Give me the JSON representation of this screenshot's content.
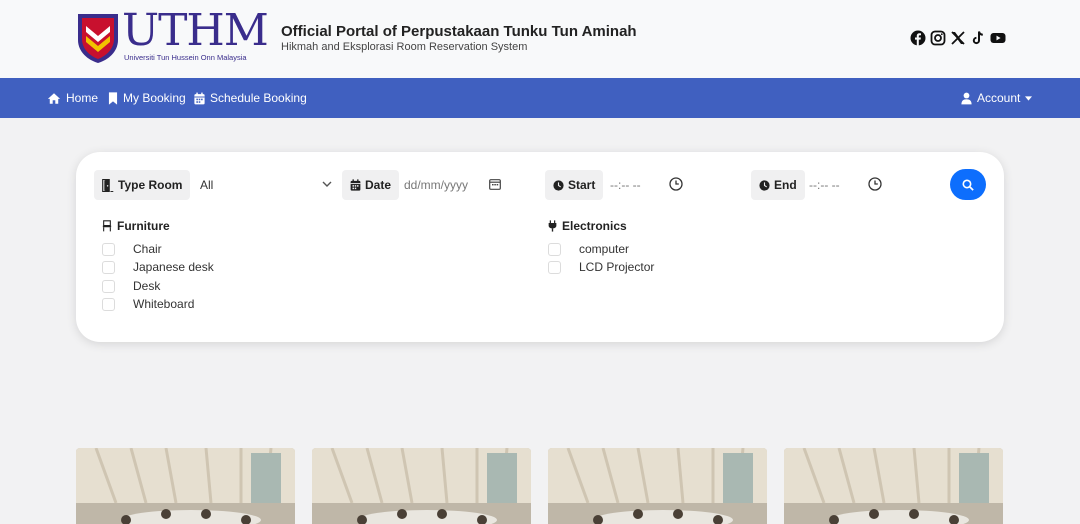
{
  "header": {
    "logo_text": "UTHM",
    "logo_subtitle": "Universiti Tun Hussein Onn Malaysia",
    "title": "Official Portal of Perpustakaan Tunku Tun Aminah",
    "subtitle": "Hikmah and Eksplorasi Room Reservation System",
    "socials": [
      "facebook-icon",
      "instagram-icon",
      "x-icon",
      "tiktok-icon",
      "youtube-icon"
    ]
  },
  "nav": {
    "home": "Home",
    "my_booking": "My Booking",
    "schedule_booking": "Schedule Booking",
    "account": "Account"
  },
  "search": {
    "type_room_label": "Type Room",
    "type_room_value": "All",
    "date_label": "Date",
    "date_placeholder": "dd/mm/yyyy",
    "start_label": "Start",
    "start_placeholder": "--:-- --",
    "end_label": "End",
    "end_placeholder": "--:-- --"
  },
  "filters": {
    "furniture_label": "Furniture",
    "furniture_items": [
      "Chair",
      "Japanese desk",
      "Desk",
      "Whiteboard"
    ],
    "electronics_label": "Electronics",
    "electronics_items": [
      "computer",
      "LCD Projector"
    ]
  },
  "colors": {
    "navbar": "#4060c0",
    "primary_button": "#0d6efd",
    "logo": "#3a2d8c"
  }
}
